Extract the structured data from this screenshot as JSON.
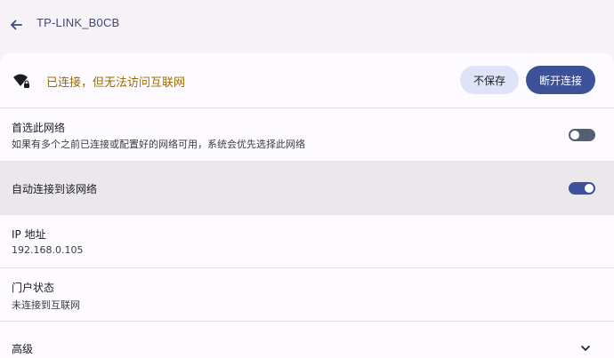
{
  "header": {
    "title": "TP-LINK_B0CB"
  },
  "status": {
    "text": "已连接，但无法访问互联网",
    "forget_label": "不保存",
    "disconnect_label": "断开连接"
  },
  "preferred_network": {
    "title": "首选此网络",
    "subtitle": "如果有多个之前已连接或配置好的网络可用，系统会优先选择此网络",
    "enabled": false
  },
  "auto_connect": {
    "title": "自动连接到该网络",
    "enabled": true
  },
  "ip_address": {
    "title": "IP 地址",
    "value": "192.168.0.105"
  },
  "portal_status": {
    "title": "门户状态",
    "value": "未连接到互联网"
  },
  "advanced": {
    "title": "高级"
  },
  "icons": [
    "back-arrow-icon",
    "wifi-no-internet-icon",
    "chevron-down-icon"
  ],
  "colors": {
    "primary": "#3c5197",
    "warning_text": "#9a6b00",
    "tonal_button": "#dfe3f7"
  }
}
